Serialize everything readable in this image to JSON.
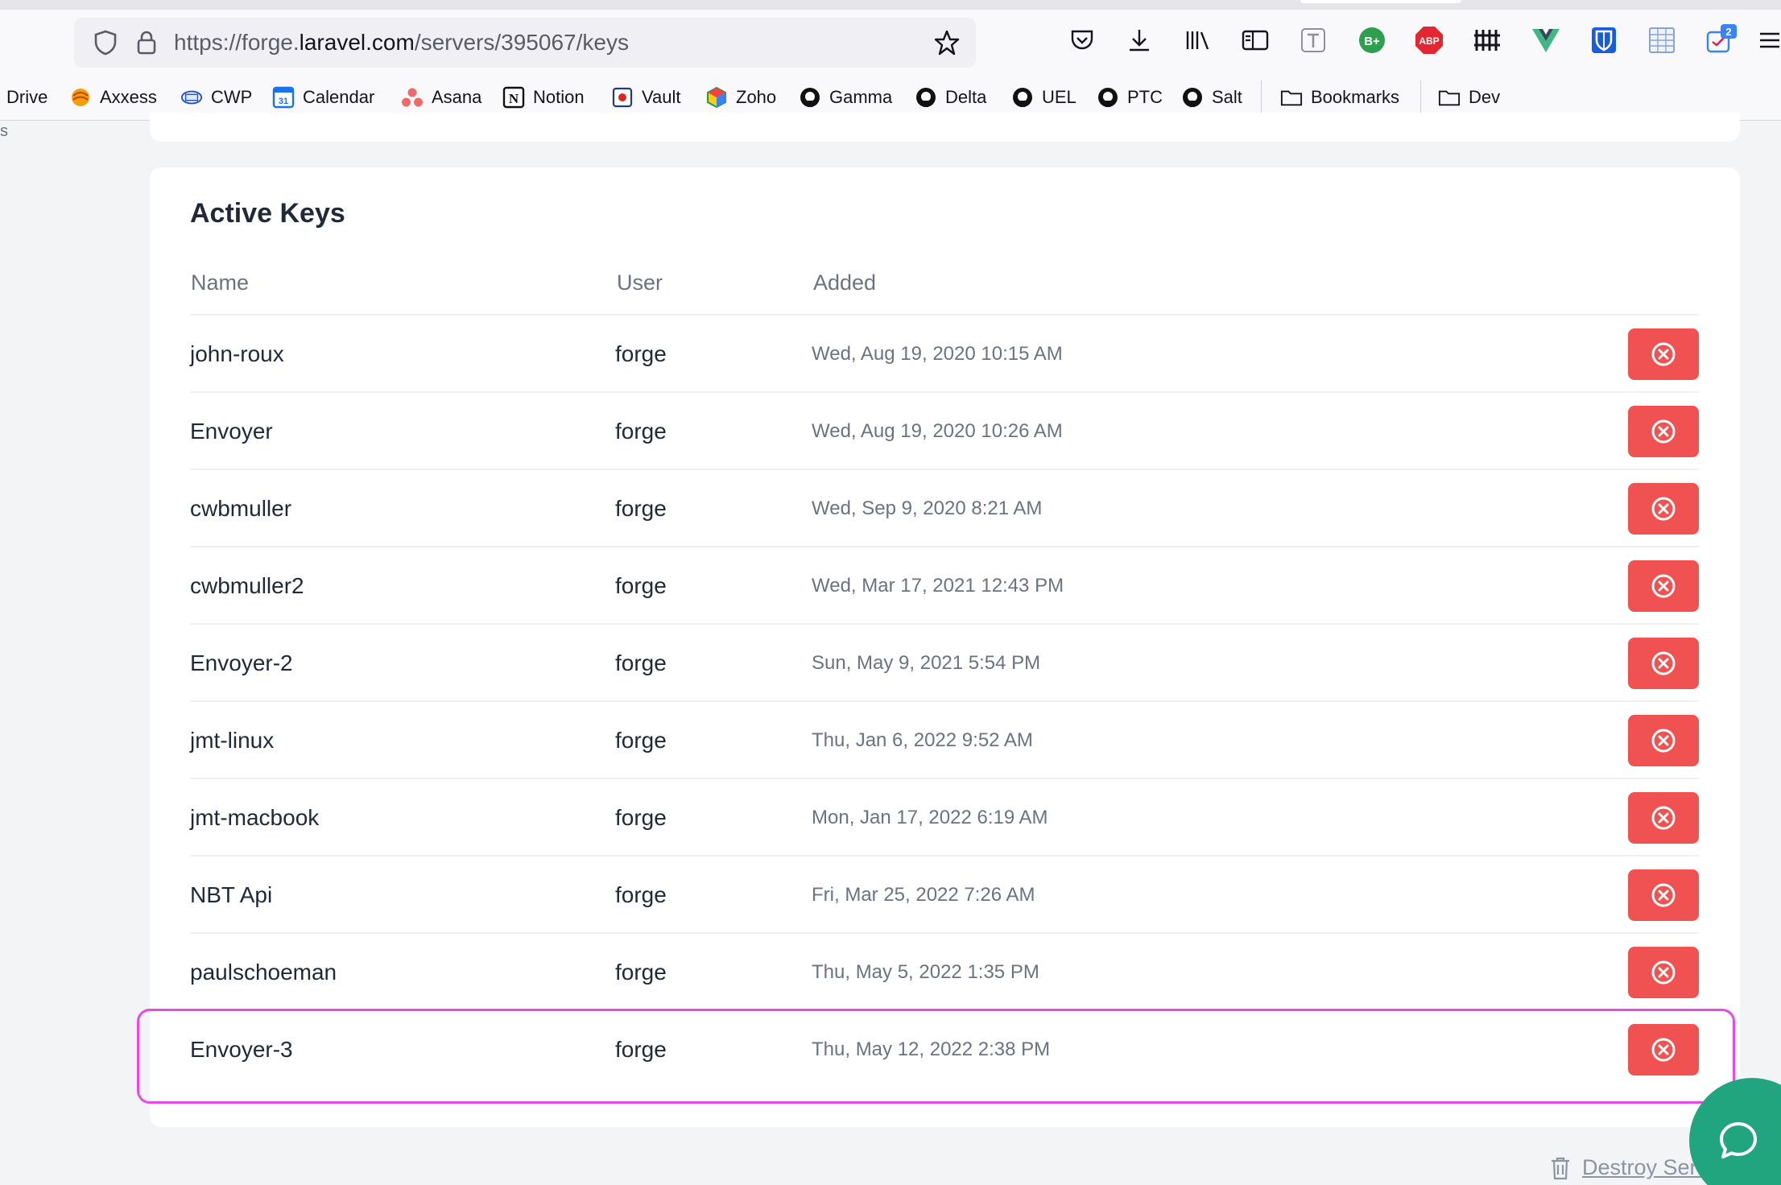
{
  "browser": {
    "url_prefix": "https://forge.",
    "url_host": "laravel.com",
    "url_path": "/servers/395067/keys",
    "tab_badge": "2",
    "bplus_label": "B+",
    "abp_label": "ABP"
  },
  "bookmarks": [
    {
      "label": "Drive",
      "icon": "drive-icon"
    },
    {
      "label": "Axxess",
      "icon": "axxess-icon"
    },
    {
      "label": "CWP",
      "icon": "cwp-icon"
    },
    {
      "label": "Calendar",
      "icon": "calendar-icon",
      "icon_text": "31"
    },
    {
      "label": "Asana",
      "icon": "asana-icon"
    },
    {
      "label": "Notion",
      "icon": "notion-icon",
      "icon_text": "N"
    },
    {
      "label": "Vault",
      "icon": "vault-icon"
    },
    {
      "label": "Zoho",
      "icon": "zoho-icon"
    },
    {
      "label": "Gamma",
      "icon": "github-icon"
    },
    {
      "label": "Delta",
      "icon": "github-icon"
    },
    {
      "label": "UEL",
      "icon": "github-icon"
    },
    {
      "label": "PTC",
      "icon": "github-icon"
    },
    {
      "label": "Salt",
      "icon": "github-icon"
    },
    {
      "label": "Bookmarks",
      "icon": "folder-icon"
    },
    {
      "label": "Dev",
      "icon": "folder-icon"
    }
  ],
  "page": {
    "edge_glyph": "s",
    "card_title": "Active Keys",
    "columns": [
      "Name",
      "User",
      "Added"
    ],
    "keys": [
      {
        "name": "john-roux",
        "user": "forge",
        "added": "Wed, Aug 19, 2020 10:15 AM"
      },
      {
        "name": "Envoyer",
        "user": "forge",
        "added": "Wed, Aug 19, 2020 10:26 AM"
      },
      {
        "name": "cwbmuller",
        "user": "forge",
        "added": "Wed, Sep 9, 2020 8:21 AM"
      },
      {
        "name": "cwbmuller2",
        "user": "forge",
        "added": "Wed, Mar 17, 2021 12:43 PM"
      },
      {
        "name": "Envoyer-2",
        "user": "forge",
        "added": "Sun, May 9, 2021 5:54 PM"
      },
      {
        "name": "jmt-linux",
        "user": "forge",
        "added": "Thu, Jan 6, 2022 9:52 AM"
      },
      {
        "name": "jmt-macbook",
        "user": "forge",
        "added": "Mon, Jan 17, 2022 6:19 AM"
      },
      {
        "name": "NBT Api",
        "user": "forge",
        "added": "Fri, Mar 25, 2022 7:26 AM"
      },
      {
        "name": "paulschoeman",
        "user": "forge",
        "added": "Thu, May 5, 2022 1:35 PM"
      },
      {
        "name": "Envoyer-3",
        "user": "forge",
        "added": "Thu, May 12, 2022 2:38 PM"
      }
    ],
    "destroy_label": "Destroy Server"
  },
  "colors": {
    "delete_button": "#f05252",
    "highlight": "#e848e8",
    "chat_bubble": "#21a57e"
  }
}
